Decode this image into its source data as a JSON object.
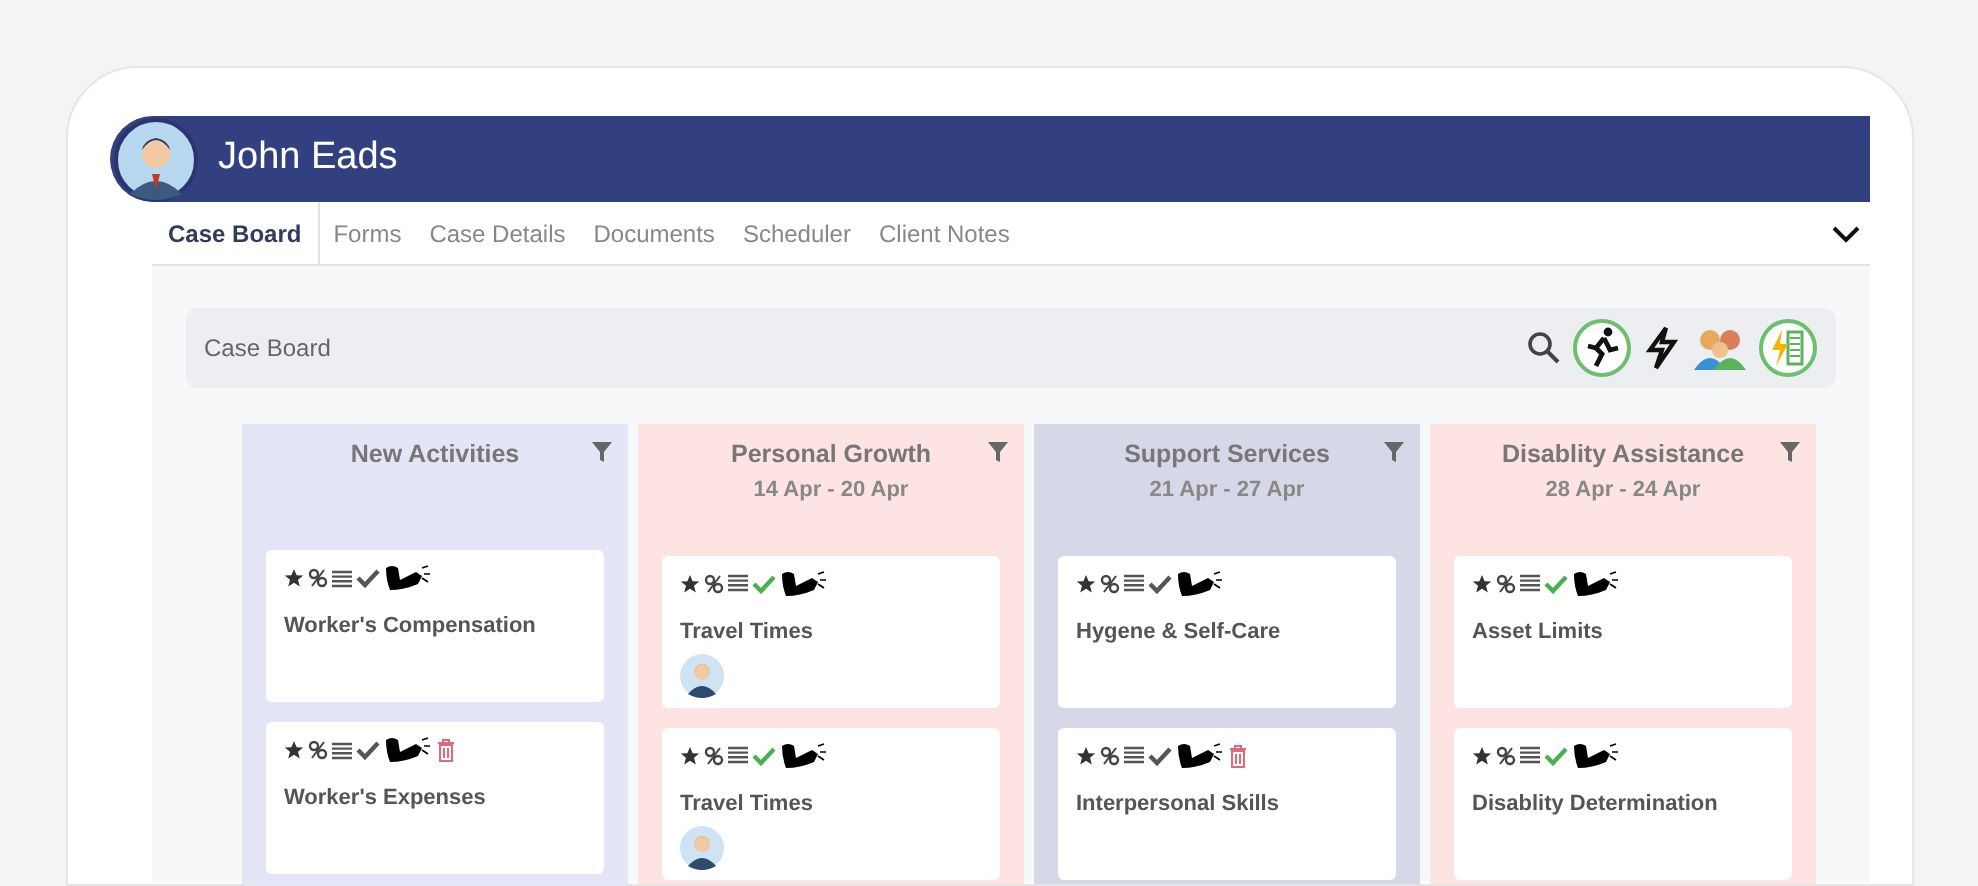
{
  "header": {
    "name": "John Eads"
  },
  "tabs": [
    {
      "label": "Case Board",
      "selected": true
    },
    {
      "label": "Forms",
      "selected": false
    },
    {
      "label": "Case Details",
      "selected": false
    },
    {
      "label": "Documents",
      "selected": false
    },
    {
      "label": "Scheduler",
      "selected": false
    },
    {
      "label": "Client Notes",
      "selected": false
    }
  ],
  "board_bar": {
    "title": "Case Board"
  },
  "columns": [
    {
      "title": "New Activities",
      "color": "#e4e6f7",
      "cards": [
        {
          "title": "Worker's Compensation",
          "checked": false,
          "deletable": false,
          "assigned": false
        },
        {
          "title": "Worker's Expenses",
          "checked": false,
          "deletable": true,
          "assigned": false
        }
      ]
    },
    {
      "title": "Personal Growth",
      "dates": "14 Apr - 20 Apr",
      "color": "#fde3e1",
      "cards": [
        {
          "title": "Travel Times",
          "checked": true,
          "deletable": false,
          "assigned": true
        },
        {
          "title": "Travel Times",
          "checked": true,
          "deletable": false,
          "assigned": true
        }
      ]
    },
    {
      "title": "Support Services",
      "dates": "21 Apr - 27 Apr",
      "color": "#d6d8e8",
      "cards": [
        {
          "title": "Hygene & Self-Care",
          "checked": false,
          "deletable": false,
          "assigned": false
        },
        {
          "title": "Interpersonal Skills",
          "checked": false,
          "deletable": true,
          "assigned": false
        }
      ]
    },
    {
      "title": "Disablity Assistance",
      "dates": "28 Apr - 24 Apr",
      "color": "#fde3e1",
      "cards": [
        {
          "title": "Asset Limits",
          "checked": true,
          "deletable": false,
          "assigned": false
        },
        {
          "title": "Disablity Determination",
          "checked": true,
          "deletable": false,
          "assigned": false
        }
      ]
    }
  ]
}
